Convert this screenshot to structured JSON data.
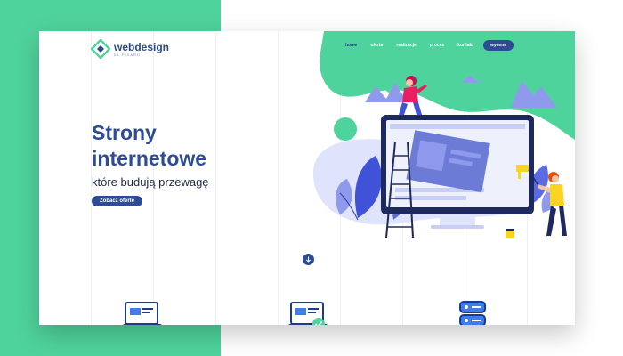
{
  "brand": {
    "name": "webdesign",
    "subtitle": "EL PIXARO",
    "accent_color": "#2d4c94",
    "green_color": "#4fd39c"
  },
  "nav": {
    "items": [
      {
        "label": "home",
        "active": true
      },
      {
        "label": "oferta",
        "active": false
      },
      {
        "label": "realizacje",
        "active": false
      },
      {
        "label": "proces",
        "active": false
      },
      {
        "label": "kontakt",
        "active": false
      }
    ],
    "cta_label": "wycena"
  },
  "hero": {
    "title_line1": "Strony",
    "title_line2": "internetowe",
    "subtitle": "które budują przewagę",
    "button_label": "Zobacz ofertę"
  },
  "scroll": {
    "icon": "arrow-down-icon"
  },
  "features": [
    {
      "icon": "laptop-icon"
    },
    {
      "icon": "laptop-check-icon"
    },
    {
      "icon": "server-icon"
    }
  ],
  "illustration": {
    "name": "website-builder-illustration"
  }
}
